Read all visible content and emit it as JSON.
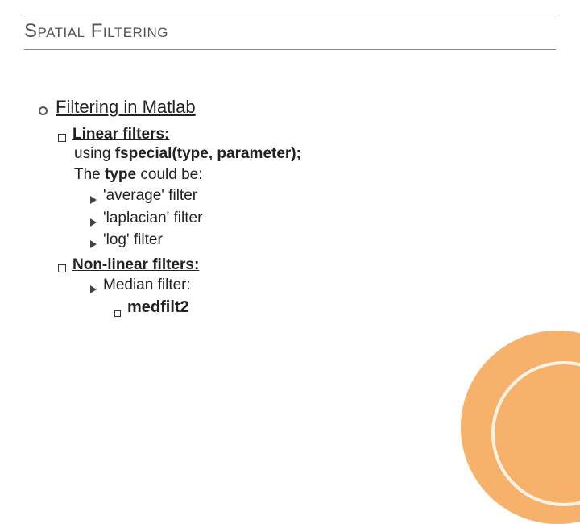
{
  "title": "Spatial Filtering",
  "section": "Filtering in Matlab",
  "linear": {
    "heading": "Linear filters:",
    "line1_prefix": "using ",
    "line1_bold": "fspecial(type, parameter);",
    "line2_prefix": "The ",
    "line2_bold": "type",
    "line2_suffix": " could be:",
    "items": [
      "'average' filter",
      "'laplacian' filter",
      "'log' filter"
    ]
  },
  "nonlinear": {
    "heading": "Non-linear filters:",
    "item": "Median filter:",
    "sub": "medfilt2"
  }
}
